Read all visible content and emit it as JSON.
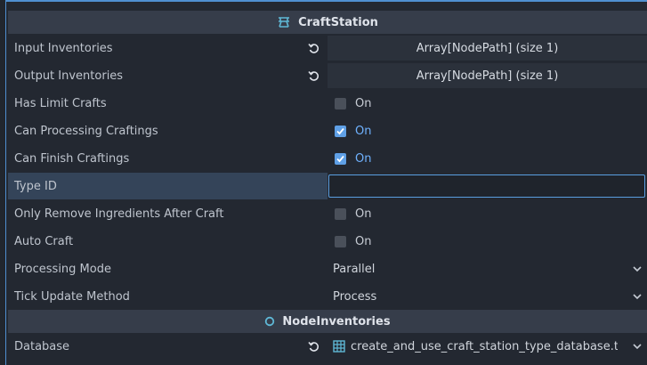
{
  "sections": {
    "craftstation": {
      "title": "CraftStation",
      "icon": "craft-station-icon"
    },
    "nodeinventories": {
      "title": "NodeInventories",
      "icon": "circle-node-icon"
    }
  },
  "rows": {
    "input_inventories": {
      "label": "Input Inventories",
      "value": "Array[NodePath] (size 1)"
    },
    "output_inventories": {
      "label": "Output Inventories",
      "value": "Array[NodePath] (size 1)"
    },
    "has_limit_crafts": {
      "label": "Has Limit Crafts",
      "value": "On",
      "checked": false
    },
    "can_processing_craftings": {
      "label": "Can Processing Craftings",
      "value": "On",
      "checked": true
    },
    "can_finish_craftings": {
      "label": "Can Finish Craftings",
      "value": "On",
      "checked": true
    },
    "type_id": {
      "label": "Type ID",
      "value": ""
    },
    "only_remove_ingredients": {
      "label": "Only Remove Ingredients After Craft",
      "value": "On",
      "checked": false
    },
    "auto_craft": {
      "label": "Auto Craft",
      "value": "On",
      "checked": false
    },
    "processing_mode": {
      "label": "Processing Mode",
      "value": "Parallel"
    },
    "tick_update_method": {
      "label": "Tick Update Method",
      "value": "Process"
    },
    "database": {
      "label": "Database",
      "value": "create_and_use_craft_station_type_database.t"
    }
  },
  "colors": {
    "accent": "#5fa0e6",
    "header": "#363d4a",
    "panel": "#232831"
  }
}
